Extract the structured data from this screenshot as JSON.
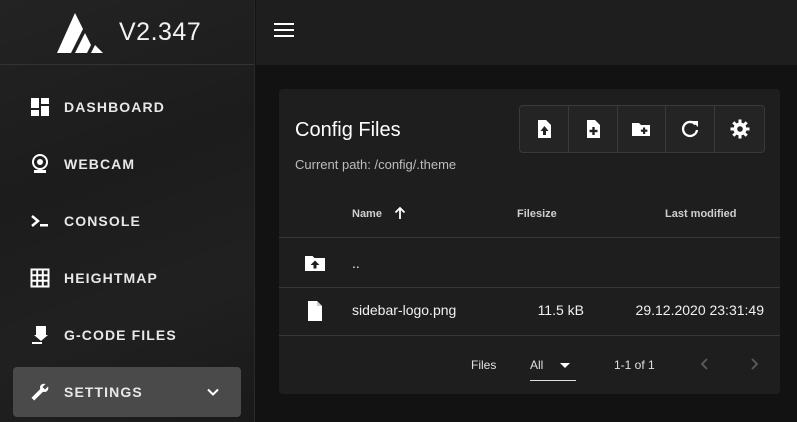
{
  "app": {
    "version": "V2.347"
  },
  "sidebar": {
    "items": [
      {
        "label": "DASHBOARD",
        "icon": "dashboard-icon"
      },
      {
        "label": "WEBCAM",
        "icon": "webcam-icon"
      },
      {
        "label": "CONSOLE",
        "icon": "console-icon"
      },
      {
        "label": "HEIGHTMAP",
        "icon": "grid-icon"
      },
      {
        "label": "G-CODE FILES",
        "icon": "file-upload-icon"
      },
      {
        "label": "SETTINGS",
        "icon": "wrench-icon",
        "active": true
      }
    ]
  },
  "card": {
    "title": "Config Files",
    "current_path": "Current path: /config/.theme",
    "toolbar": [
      "upload-file-icon",
      "new-file-icon",
      "new-folder-icon",
      "refresh-icon",
      "gear-icon"
    ]
  },
  "table": {
    "headers": {
      "name": "Name",
      "filesize": "Filesize",
      "last_modified": "Last modified"
    },
    "rows": [
      {
        "name": "..",
        "size": "",
        "modified": "",
        "icon": "folder-up-icon"
      },
      {
        "name": "sidebar-logo.png",
        "size": "11.5 kB",
        "modified": "29.12.2020 23:31:49",
        "icon": "file-icon"
      }
    ]
  },
  "footer": {
    "files_label": "Files",
    "per_page": "All",
    "range": "1-1 of 1"
  },
  "colors": {
    "background": "#121212",
    "sidebar": "#1c1c1c",
    "card": "#1e1e1e",
    "active_item": "#4a4a4a"
  }
}
